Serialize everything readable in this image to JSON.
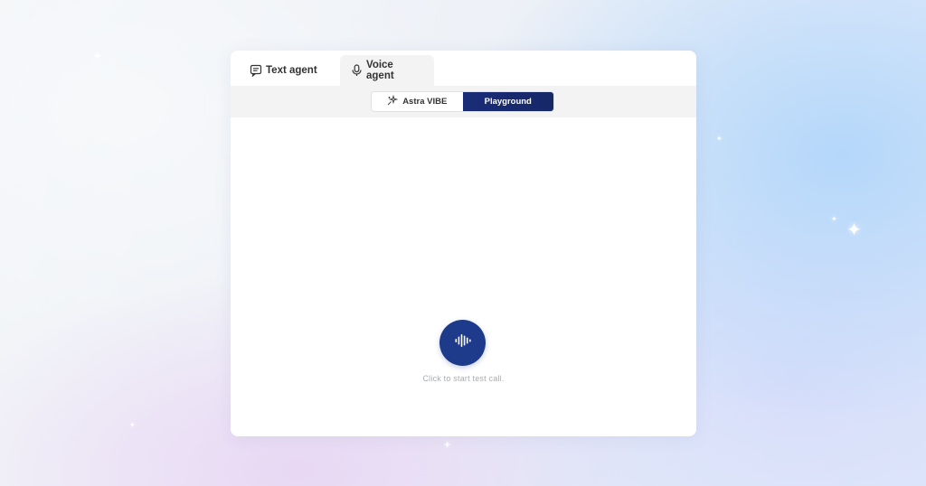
{
  "tabs": {
    "text_agent": "Text agent",
    "voice_agent": "Voice agent",
    "active": "voice_agent"
  },
  "mode_switch": {
    "astra_vibe": "Astra VIBE",
    "playground": "Playground",
    "active": "playground"
  },
  "call": {
    "hint": "Click to start test call.",
    "button_icon": "soundwave-icon"
  },
  "colors": {
    "accent": "#1e3a8a",
    "switch_active": "#1a2c78",
    "tab_active_bg": "#f3f3f3",
    "hint_text": "#a7acb5"
  }
}
